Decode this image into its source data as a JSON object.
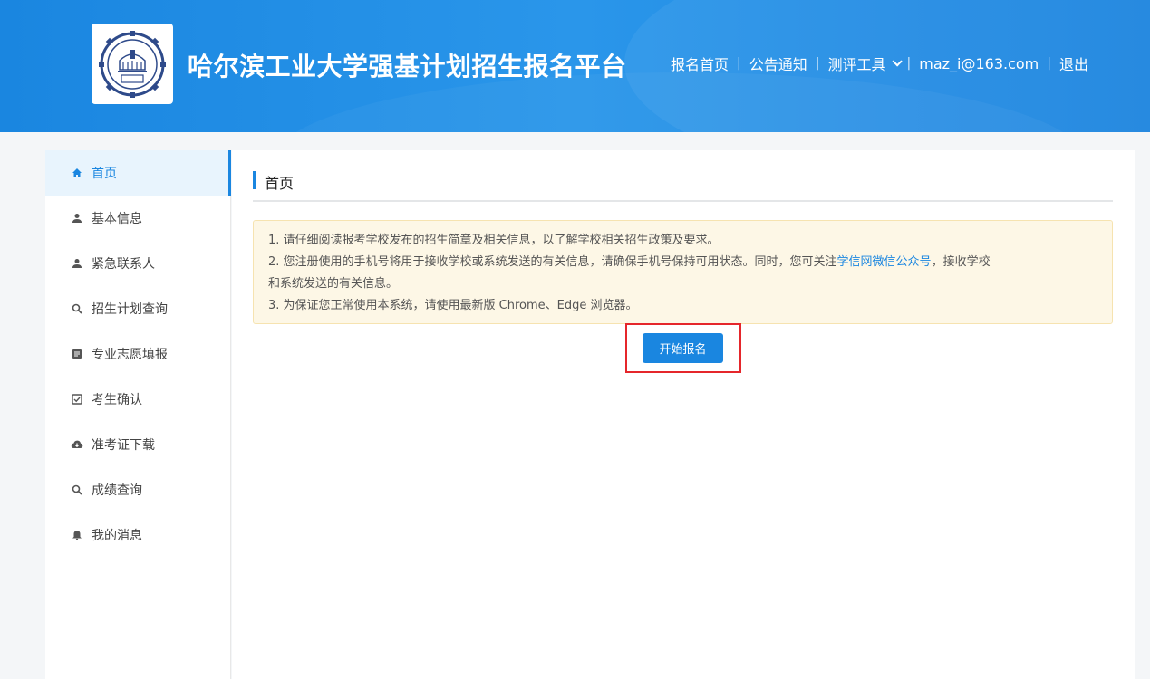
{
  "header": {
    "site_title": "哈尔滨工业大学强基计划招生报名平台",
    "logo_icon": "hit-university-seal",
    "nav": {
      "home": "报名首页",
      "notices": "公告通知",
      "tools": "测评工具",
      "user": "maz_i@163.com",
      "logout": "退出"
    }
  },
  "sidebar": {
    "items": [
      {
        "label": "首页",
        "icon": "home-icon",
        "active": true
      },
      {
        "label": "基本信息",
        "icon": "user-icon"
      },
      {
        "label": "紧急联系人",
        "icon": "user-icon"
      },
      {
        "label": "招生计划查询",
        "icon": "search-icon"
      },
      {
        "label": "专业志愿填报",
        "icon": "form-icon"
      },
      {
        "label": "考生确认",
        "icon": "checkbox-icon"
      },
      {
        "label": "准考证下载",
        "icon": "cloud-download-icon"
      },
      {
        "label": "成绩查询",
        "icon": "search-icon"
      },
      {
        "label": "我的消息",
        "icon": "bell-icon"
      }
    ]
  },
  "main": {
    "page_title": "首页",
    "notice": {
      "line1": "1. 请仔细阅读报考学校发布的招生简章及相关信息，以了解学校相关招生政策及要求。",
      "line2_pre": "2. 您注册使用的手机号将用于接收学校或系统发送的有关信息，请确保手机号保持可用状态。同时，您可关注",
      "line2_link": "学信网微信公众号",
      "line2_post": "，接收学校",
      "line2_cont": "和系统发送的有关信息。",
      "line3": "3. 为保证您正常使用本系统，请使用最新版 Chrome、Edge 浏览器。"
    },
    "start_button": "开始报名"
  },
  "colors": {
    "brand": "#1a86e0",
    "highlight_box": "#e5262b",
    "notice_bg": "#fdf7e6"
  }
}
